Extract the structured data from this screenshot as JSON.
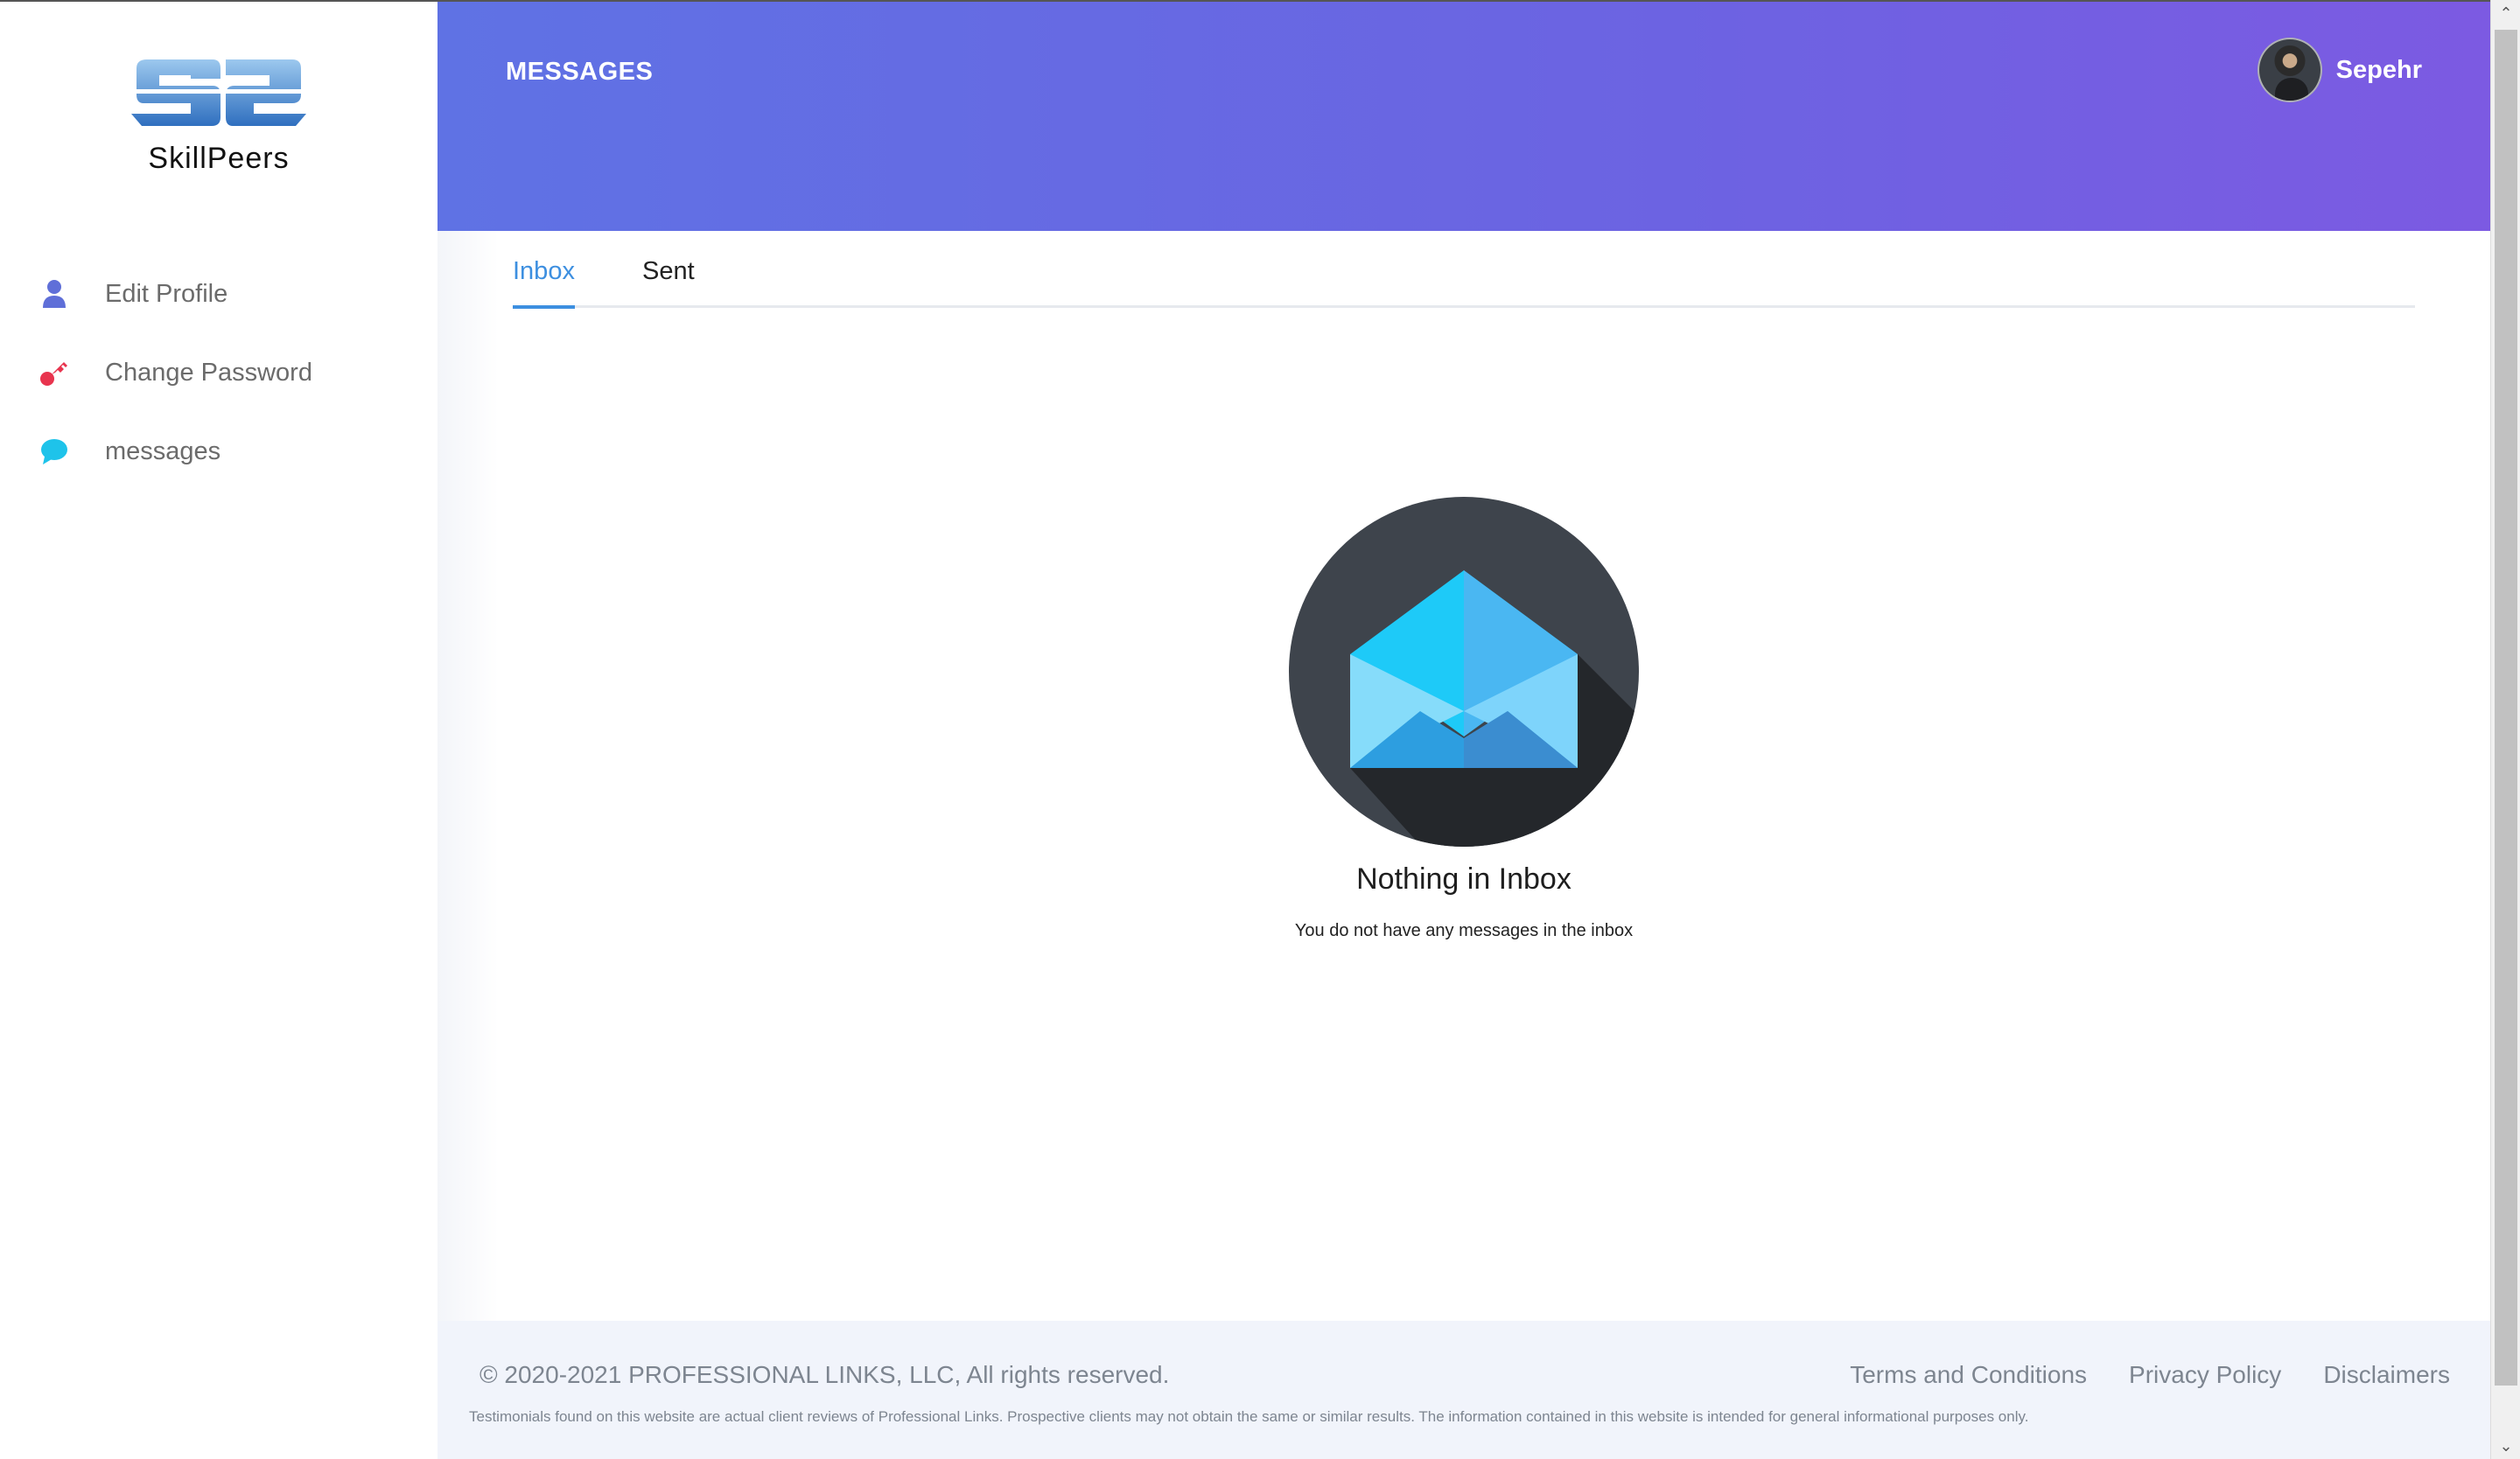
{
  "brand": {
    "name": "SkillPeers",
    "logo_color": "#4a90d6"
  },
  "sidebar": {
    "items": [
      {
        "label": "Edit Profile",
        "icon": "user-icon",
        "icon_color": "#5f6fd8"
      },
      {
        "label": "Change Password",
        "icon": "key-icon",
        "icon_color": "#e8344e"
      },
      {
        "label": "messages",
        "icon": "chat-bubble-icon",
        "icon_color": "#1ec3ea"
      }
    ]
  },
  "header": {
    "title": "MESSAGES",
    "user_name": "Sepehr",
    "gradient": [
      "#5f72e4",
      "#7c5ae2"
    ]
  },
  "tabs": [
    {
      "label": "Inbox",
      "active": true
    },
    {
      "label": "Sent",
      "active": false
    }
  ],
  "accent_color": "#3d8fe0",
  "empty_state": {
    "icon": "open-envelope-icon",
    "title": "Nothing in Inbox",
    "subtitle": "You do not have any messages in the inbox"
  },
  "footer": {
    "copyright": "© 2020-2021 PROFESSIONAL LINKS, LLC, All rights reserved.",
    "links": [
      "Terms and Conditions",
      "Privacy Policy",
      "Disclaimers"
    ],
    "disclaimer": "Testimonials found on this website are actual client reviews of Professional Links. Prospective clients may not obtain the same or similar results. The information contained in this website is intended for general informational purposes only."
  }
}
